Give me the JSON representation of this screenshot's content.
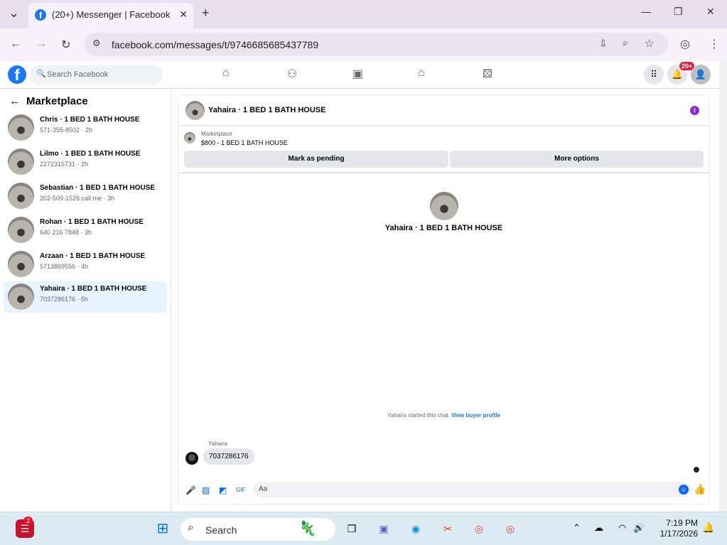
{
  "browser": {
    "tab_title": "(20+) Messenger | Facebook",
    "url": "facebook.com/messages/t/9746685685437789"
  },
  "fb": {
    "search_placeholder": "Search Facebook",
    "notif_badge": "20+"
  },
  "sidebar": {
    "title": "Marketplace",
    "conversations": [
      {
        "name": "Chris · 1 BED 1 BATH HOUSE",
        "sub": "571-355-8502 · 2h"
      },
      {
        "name": "Lilmo · 1 BED 1 BATH HOUSE",
        "sub": "2272315731 · 2h"
      },
      {
        "name": "Sebastian · 1 BED 1 BATH HOUSE",
        "sub": "202-509-1526 call me · 3h"
      },
      {
        "name": "Rohan · 1 BED 1 BATH HOUSE",
        "sub": "640 216 7848 · 3h"
      },
      {
        "name": "Arzaan · 1 BED 1 BATH HOUSE",
        "sub": "5713869556 · 4h"
      },
      {
        "name": "Yahaira · 1 BED 1 BATH HOUSE",
        "sub": "7037286176 · 5h"
      }
    ]
  },
  "chat": {
    "title": "Yahaira · 1 BED 1 BATH HOUSE",
    "listing_label": "Marketplace",
    "listing_price": "$800 - 1 BED 1 BATH HOUSE",
    "mark_pending": "Mark as pending",
    "more_options": "More options",
    "center_name": "Yahaira · 1 BED 1 BATH HOUSE",
    "started_text": "Yahaira started this chat.",
    "view_profile": "View buyer profile",
    "sender": "Yahaira",
    "message": "7037286176",
    "composer_placeholder": "Aa"
  },
  "taskbar": {
    "search": "Search",
    "time": "7:19 PM",
    "date": "1/17/2026",
    "badge": "2"
  }
}
